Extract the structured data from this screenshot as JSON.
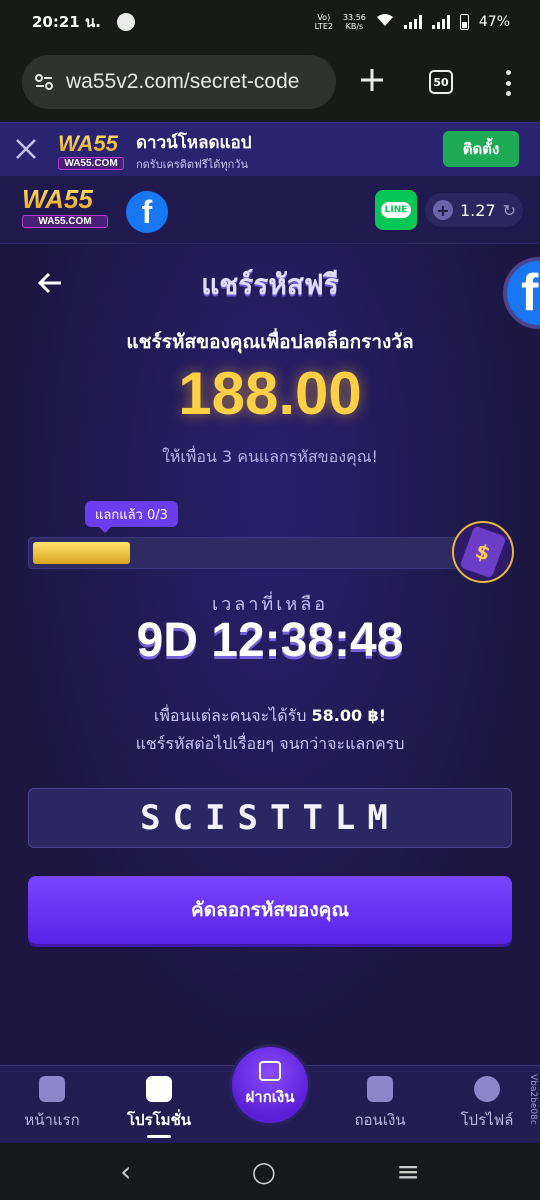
{
  "status_bar": {
    "time": "20:21 น.",
    "network_top": "Vo)",
    "network_bottom": "LTE2",
    "speed_top": "33.56",
    "speed_bottom": "KB/s",
    "battery": "47%"
  },
  "browser": {
    "url": "wa55v2.com/secret-code",
    "tab_count": "50"
  },
  "download_banner": {
    "logo_main": "WA55",
    "logo_sub": "WA55.COM",
    "title": "ดาวน์โหลดแอป",
    "subtitle": "กดรับเครดิตฟรีได้ทุกวัน",
    "install_label": "ติดตั้ง"
  },
  "header": {
    "logo_main": "WA55",
    "logo_sub": "WA55.COM",
    "line_label": "LINE",
    "balance": "1.27"
  },
  "page": {
    "title": "แชร์รหัสฟรี",
    "subtitle": "แชร์รหัสของคุณเพื่อปลดล็อกรางวัล",
    "reward": "188.00",
    "invite_text": "ให้เพื่อน 3 คนแลกรหัสของคุณ!",
    "progress_label": "แลกแล้ว 0/3",
    "progress_fraction": 0.22,
    "progress_icon_symbol": "$",
    "time_left_label": "เวลาที่เหลือ",
    "countdown": "9D 12:38:48",
    "info_line1_prefix": "เพื่อนแต่ละคนจะได้รับ",
    "info_amount": "58.00 ฿!",
    "info_line2": "แชร์รหัสต่อไปเรื่อยๆ จนกว่าจะแลกครบ",
    "code": "SCISTTLM",
    "copy_label": "คัดลอกรหัสของคุณ"
  },
  "bottom_nav": {
    "home": "หน้าแรก",
    "promotions": "โปรโมชั่น",
    "deposit": "ฝากเงิน",
    "withdraw": "ถอนเงิน",
    "profile": "โปรไฟล์",
    "side_code": "Vba2be08c"
  },
  "colors": {
    "accent_purple": "#6a3df0",
    "reward_gold": "#ffcf45",
    "install_green": "#1faa55",
    "facebook_blue": "#1877f2",
    "line_green": "#06c755"
  }
}
